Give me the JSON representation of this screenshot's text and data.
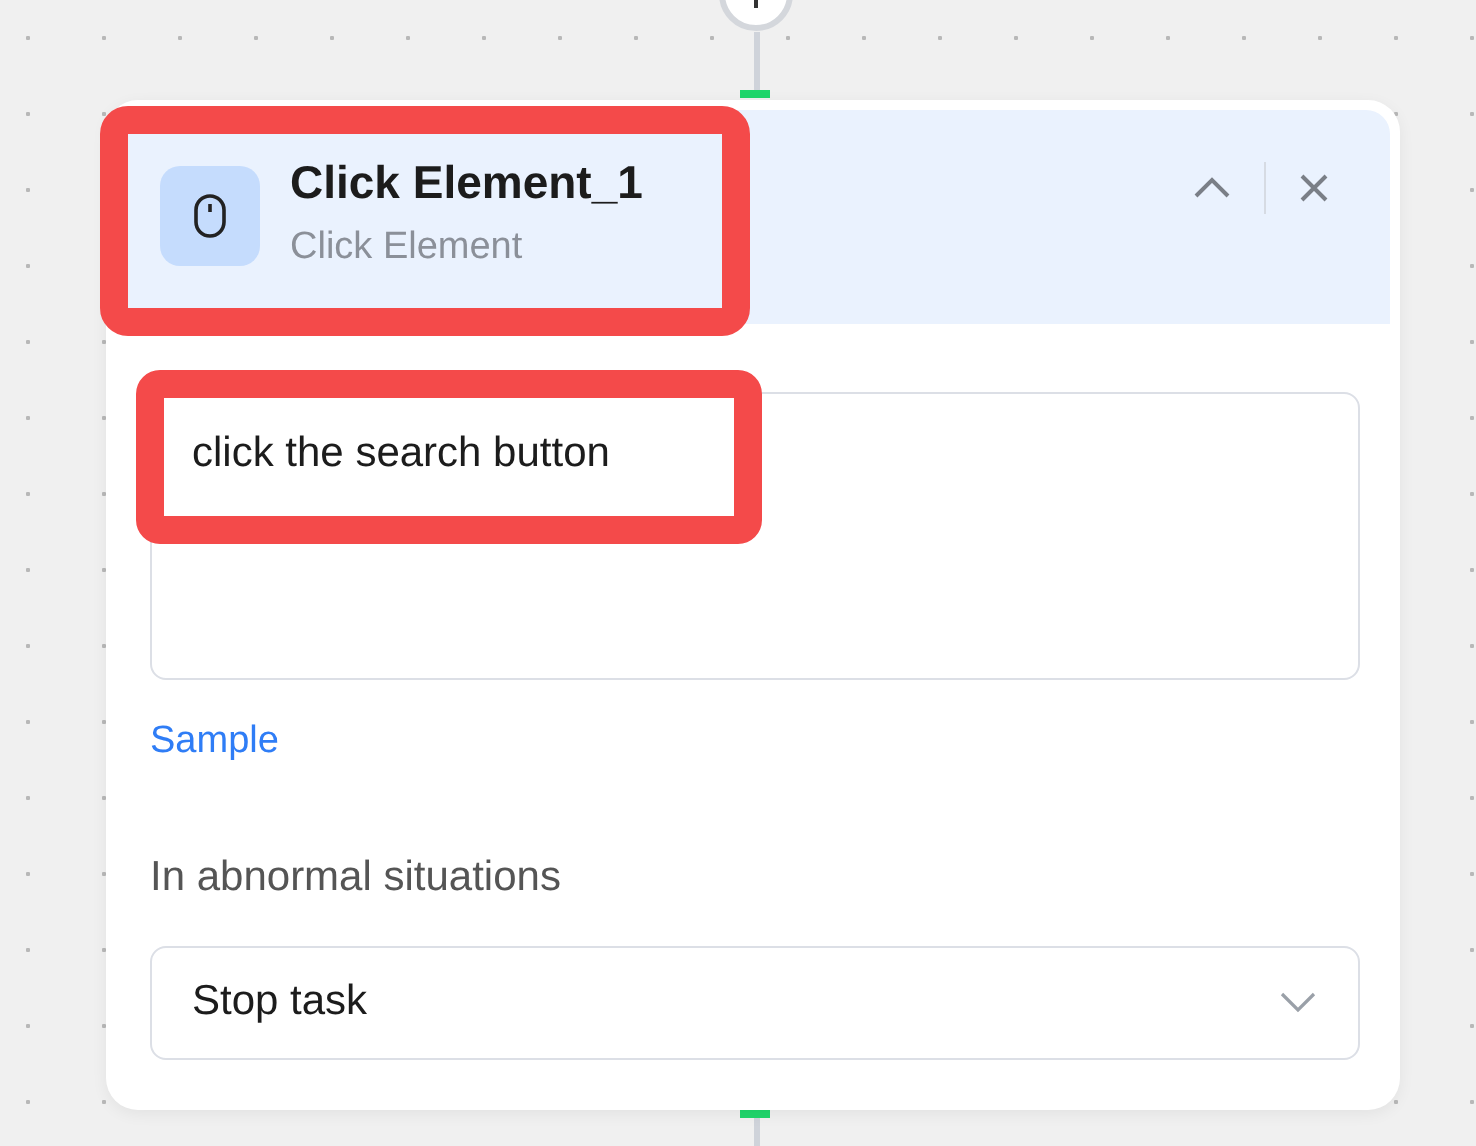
{
  "node": {
    "title": "Click Element_1",
    "subtitle": "Click Element",
    "highlighted": true
  },
  "prompt": {
    "value": "click the search button",
    "highlighted": true
  },
  "sample_link": "Sample",
  "abnormal": {
    "label": "In abnormal situations",
    "value": "Stop task"
  }
}
